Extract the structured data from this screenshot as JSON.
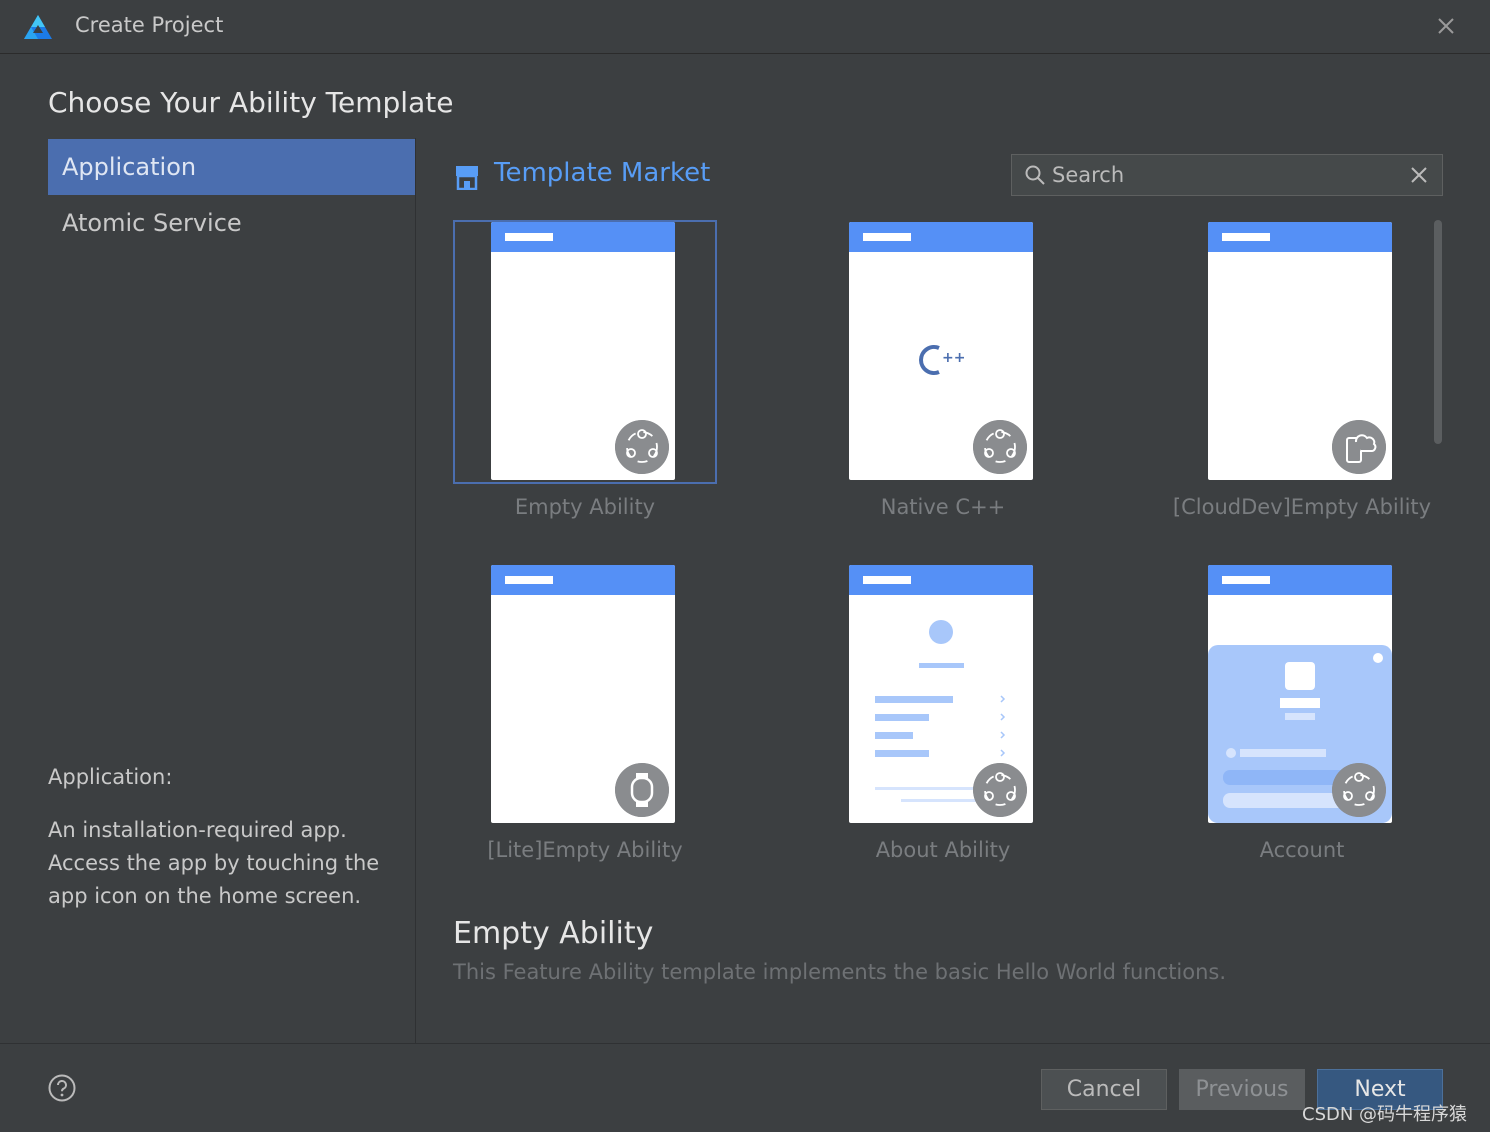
{
  "window": {
    "title": "Create Project",
    "close_icon": "close-icon"
  },
  "heading": "Choose Your Ability Template",
  "sidebar": {
    "items": [
      {
        "label": "Application",
        "selected": true
      },
      {
        "label": "Atomic Service",
        "selected": false
      }
    ],
    "description_title": "Application:",
    "description": "An installation-required app. Access the app by touching the app icon on the home screen."
  },
  "market": {
    "title": "Template Market"
  },
  "search": {
    "placeholder": "Search",
    "value": ""
  },
  "templates": [
    {
      "name": "Empty Ability",
      "selected": true,
      "badge": "ability-icon"
    },
    {
      "name": "Native C++",
      "selected": false,
      "badge": "ability-icon",
      "center_text": "C++"
    },
    {
      "name": "[CloudDev]Empty Ability",
      "selected": false,
      "badge": "cloud-device-icon"
    },
    {
      "name": "[Lite]Empty Ability",
      "selected": false,
      "badge": "watch-icon"
    },
    {
      "name": "About Ability",
      "selected": false,
      "badge": "ability-icon"
    },
    {
      "name": "Account",
      "selected": false,
      "badge": "ability-icon"
    }
  ],
  "detail": {
    "title": "Empty Ability",
    "description": "This Feature Ability template implements the basic Hello World functions."
  },
  "footer": {
    "cancel": "Cancel",
    "previous": "Previous",
    "next": "Next",
    "help_icon": "help-icon"
  },
  "watermark": "CSDN @码牛程序猿",
  "colors": {
    "accent": "#4b6eaf",
    "link": "#589df6",
    "phone_header": "#5590f6",
    "background": "#3c3f41"
  }
}
